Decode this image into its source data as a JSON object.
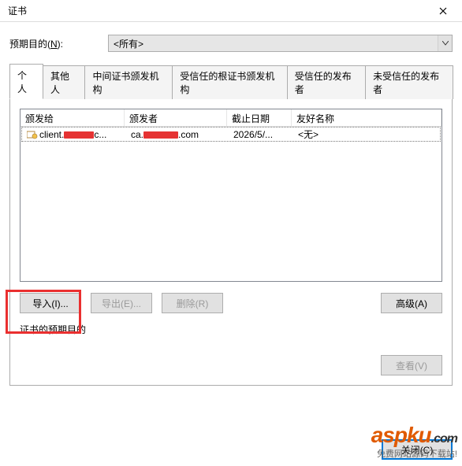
{
  "window": {
    "title": "证书"
  },
  "purpose": {
    "label_pre": "预期目的(",
    "label_hot": "N",
    "label_post": "):",
    "selected": "<所有>"
  },
  "tabs": [
    {
      "label": "个人",
      "active": true
    },
    {
      "label": "其他人"
    },
    {
      "label": "中间证书颁发机构"
    },
    {
      "label": "受信任的根证书颁发机构"
    },
    {
      "label": "受信任的发布者"
    },
    {
      "label": "未受信任的发布者"
    }
  ],
  "columns": {
    "issued_to": "颁发给",
    "issued_by": "颁发者",
    "expiration": "截止日期",
    "friendly_name": "友好名称"
  },
  "rows": [
    {
      "issued_to_prefix": "client.",
      "issued_to_suffix": "c...",
      "issued_by_prefix": "ca.",
      "issued_by_suffix": ".com",
      "expiration": "2026/5/...",
      "friendly_name": "<无>"
    }
  ],
  "buttons": {
    "import": "导入(I)...",
    "export": "导出(E)...",
    "delete": "删除(R)",
    "advanced": "高级(A)",
    "view": "查看(V)",
    "close": "关闭(C)"
  },
  "section": {
    "purpose_header": "证书的预期目的"
  },
  "watermark": {
    "brand_main": "aspku",
    "brand_ext": ".com",
    "tagline": "免费网站源码下载站!"
  }
}
